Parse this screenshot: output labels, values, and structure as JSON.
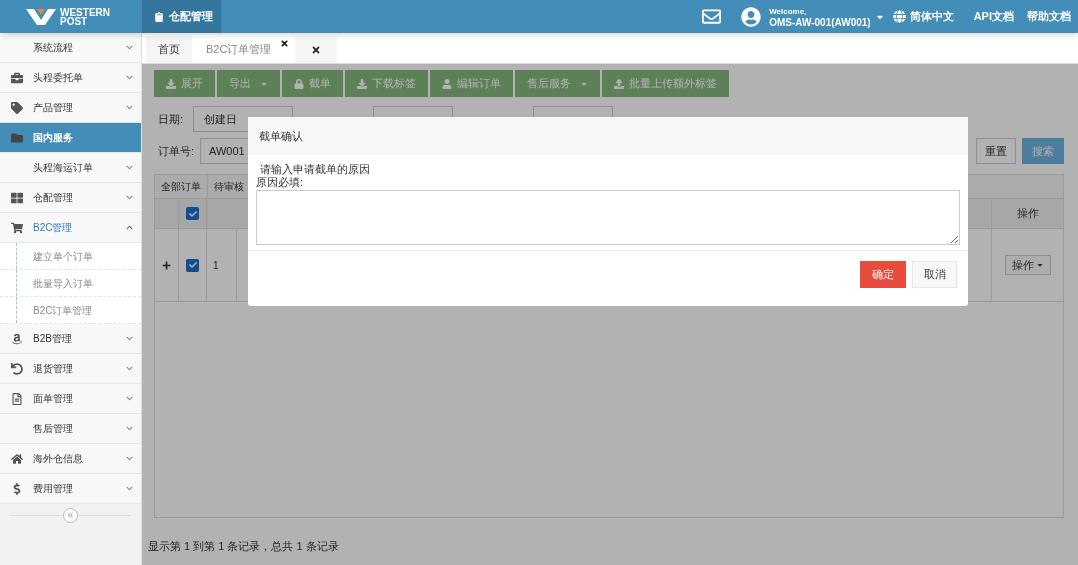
{
  "header": {
    "logo_line1": "WESTERN",
    "logo_line2": "POST",
    "nav_tab": "仓配管理",
    "welcome": "Welcome,",
    "user": "OMS-AW-001(AW001)",
    "language": "简体中文",
    "links": [
      "API文档",
      "帮助文档"
    ]
  },
  "sidebar": {
    "items": [
      {
        "label": "系统流程",
        "selected": false,
        "expanded": false
      },
      {
        "label": "头程委托单",
        "selected": false,
        "expanded": false
      },
      {
        "label": "产品管理",
        "selected": false,
        "expanded": false
      },
      {
        "label": "国内服务",
        "selected": true,
        "expanded": false,
        "no_chevron": true
      },
      {
        "label": "头程海运订单",
        "selected": false,
        "expanded": false
      },
      {
        "label": "仓配管理",
        "selected": false,
        "expanded": false
      },
      {
        "label": "B2C管理",
        "selected": false,
        "expanded": true,
        "children": [
          {
            "label": "建立单个订单"
          },
          {
            "label": "批量导入订单"
          },
          {
            "label": "B2C订单管理"
          }
        ]
      },
      {
        "label": "B2B管理",
        "selected": false,
        "expanded": false
      },
      {
        "label": "退货管理",
        "selected": false,
        "expanded": false
      },
      {
        "label": "面单管理",
        "selected": false,
        "expanded": false
      },
      {
        "label": "售后管理",
        "selected": false,
        "expanded": false
      },
      {
        "label": "海外仓信息",
        "selected": false,
        "expanded": false
      },
      {
        "label": "费用管理",
        "selected": false,
        "expanded": false
      }
    ],
    "collapse": "«"
  },
  "page_tabs": [
    {
      "label": "首页",
      "selected": false,
      "close": false
    },
    {
      "label": "B2C订单管理",
      "selected": true,
      "close": true
    },
    {
      "selected": false,
      "close": true
    }
  ],
  "toolbar": [
    {
      "label": "展开",
      "dropdown": false
    },
    {
      "label": "导出",
      "dropdown": true
    },
    {
      "label": "截单",
      "dropdown": false
    },
    {
      "label": "下载标签",
      "dropdown": false
    },
    {
      "label": "编辑订单",
      "dropdown": false
    },
    {
      "label": "售后服务",
      "dropdown": true
    },
    {
      "label": "批量上传额外标签",
      "dropdown": false
    }
  ],
  "filters": {
    "date_label": "日期:",
    "date_type": "创建日",
    "order_label": "订单号:",
    "order_value": "AW001",
    "reset": "重置",
    "search": "搜索"
  },
  "table": {
    "status_tabs": [
      "全部订单",
      "待审核"
    ],
    "header_checked": true,
    "action_column": "操作",
    "rows": [
      {
        "number": "1",
        "checked": true,
        "action": "操作"
      }
    ]
  },
  "footer": "显示第 1 到第 1 条记录，总共 1 条记录",
  "dialog": {
    "title": "截单确认",
    "prompt": "请输入申请截单的原因",
    "field_label": "原因必填:",
    "confirm": "确定",
    "cancel": "取消"
  }
}
